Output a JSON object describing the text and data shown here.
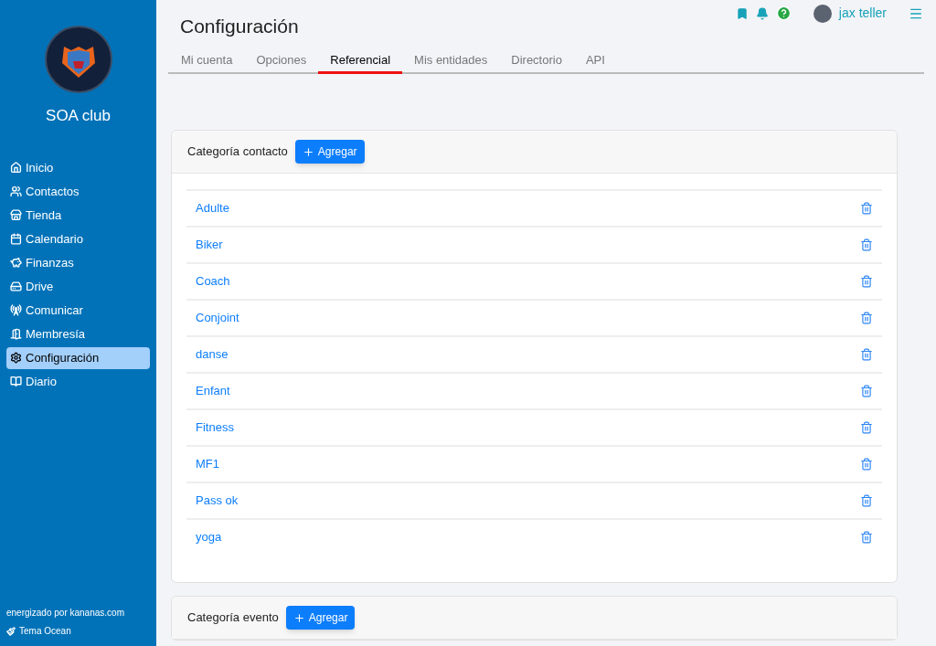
{
  "sidebar": {
    "club_name": "SOA club",
    "items": [
      {
        "label": "Inicio",
        "selected": false
      },
      {
        "label": "Contactos",
        "selected": false
      },
      {
        "label": "Tienda",
        "selected": false
      },
      {
        "label": "Calendario",
        "selected": false
      },
      {
        "label": "Finanzas",
        "selected": false
      },
      {
        "label": "Drive",
        "selected": false
      },
      {
        "label": "Comunicar",
        "selected": false
      },
      {
        "label": "Membresía",
        "selected": false
      },
      {
        "label": "Configuración",
        "selected": true
      },
      {
        "label": "Diario",
        "selected": false
      }
    ],
    "footer": {
      "powered_by": "energizado por kananas.com",
      "theme": "Tema Ocean"
    }
  },
  "header": {
    "title": "Configuración",
    "user": "jax teller"
  },
  "tabs": [
    {
      "label": "Mi cuenta",
      "selected": false
    },
    {
      "label": "Opciones",
      "selected": false
    },
    {
      "label": "Referencial",
      "selected": true
    },
    {
      "label": "Mis entidades",
      "selected": false
    },
    {
      "label": "Directorio",
      "selected": false
    },
    {
      "label": "API",
      "selected": false
    }
  ],
  "sections": [
    {
      "title": "Categoría contacto",
      "add_button": "Agregar",
      "items": [
        "Adulte",
        "Biker",
        "Coach",
        "Conjoint",
        "danse",
        "Enfant",
        "Fitness",
        "MF1",
        "Pass ok",
        "yoga"
      ]
    },
    {
      "title": "Categoría evento",
      "add_button": "Agregar"
    }
  ]
}
